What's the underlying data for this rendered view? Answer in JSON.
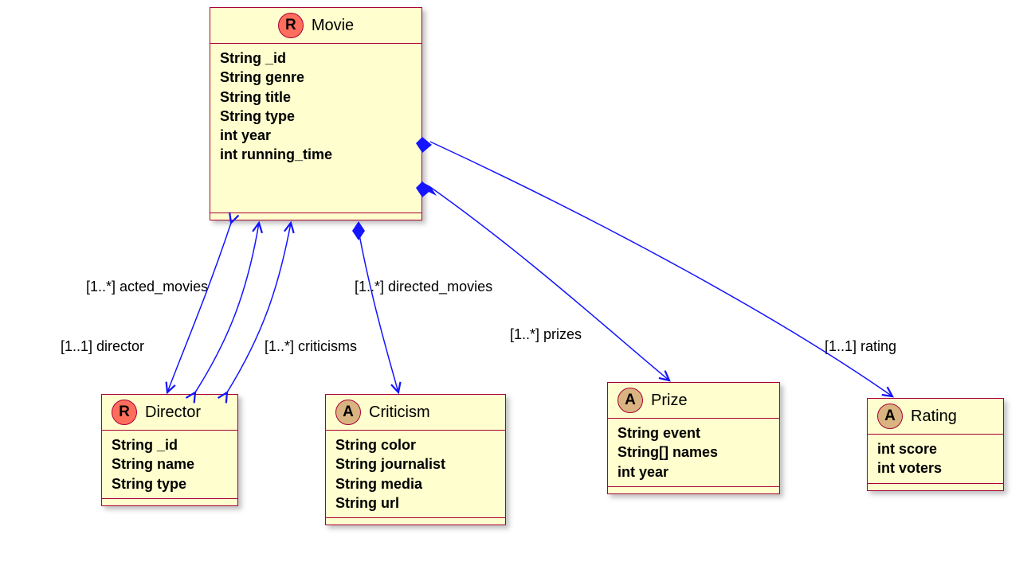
{
  "classes": {
    "movie": {
      "name": "Movie",
      "stereotype": "R",
      "attrs": [
        "String _id",
        "String genre",
        "String title",
        "String type",
        "int year",
        "int running_time"
      ]
    },
    "director": {
      "name": "Director",
      "stereotype": "R",
      "attrs": [
        "String _id",
        "String name",
        "String type"
      ]
    },
    "criticism": {
      "name": "Criticism",
      "stereotype": "A",
      "attrs": [
        "String color",
        "String journalist",
        "String media",
        "String url"
      ]
    },
    "prize": {
      "name": "Prize",
      "stereotype": "A",
      "attrs": [
        "String event",
        "String[] names",
        "int year"
      ]
    },
    "rating": {
      "name": "Rating",
      "stereotype": "A",
      "attrs": [
        "int score",
        "int voters"
      ]
    }
  },
  "edges": {
    "acted_movies": "[1..*] acted_movies",
    "directed_movies": "[1..*] directed_movies",
    "director": "[1..1] director",
    "criticisms": "[1..*] criticisms",
    "prizes": "[1..*] prizes",
    "rating": "[1..1] rating"
  }
}
